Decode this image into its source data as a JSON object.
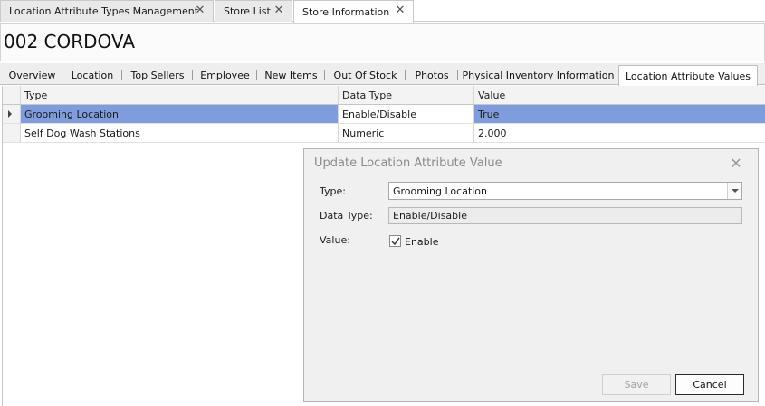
{
  "doc_tabs": [
    {
      "label": "Location Attribute Types Management",
      "active": false
    },
    {
      "label": "Store List",
      "active": false
    },
    {
      "label": "Store Information",
      "active": true
    }
  ],
  "store_title": "002 CORDOVA",
  "inner_tabs": [
    "Overview",
    "Location",
    "Top Sellers",
    "Employee",
    "New Items",
    "Out Of Stock",
    "Photos",
    "Physical Inventory Information",
    "Location Attribute Values"
  ],
  "active_inner_tab": "Location Attribute Values",
  "grid": {
    "columns": [
      "Type",
      "Data Type",
      "Value"
    ],
    "rows": [
      {
        "type": "Grooming Location",
        "data_type": "Enable/Disable",
        "value": "True",
        "selected": true
      },
      {
        "type": "Self Dog Wash Stations",
        "data_type": "Numeric",
        "value": "2.000",
        "selected": false
      }
    ]
  },
  "dialog": {
    "title": "Update Location Attribute Value",
    "type_label": "Type:",
    "type_value": "Grooming Location",
    "data_type_label": "Data Type:",
    "data_type_value": "Enable/Disable",
    "value_label": "Value:",
    "checkbox_label": "Enable",
    "checkbox_checked": true,
    "save_label": "Save",
    "cancel_label": "Cancel"
  },
  "colors": {
    "selection": "#7f9ddc",
    "dialog_bg": "#f0f0f0"
  }
}
